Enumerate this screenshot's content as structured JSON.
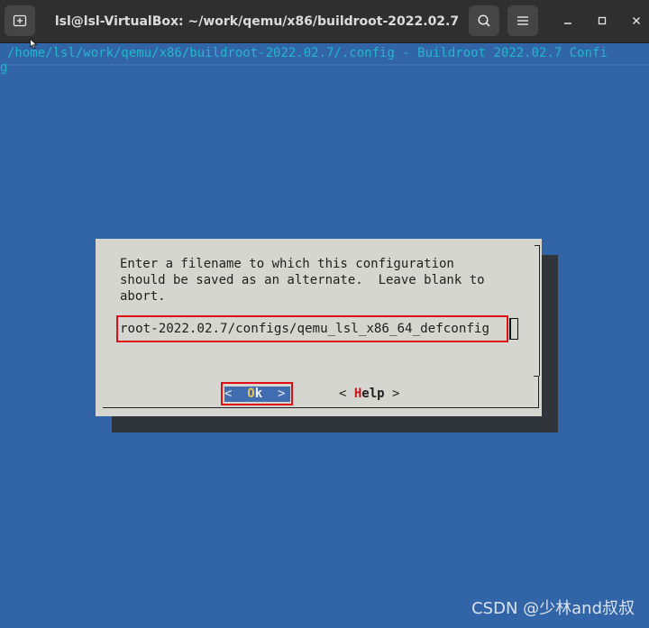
{
  "window": {
    "title": "lsl@lsl-VirtualBox: ~/work/qemu/x86/buildroot-2022.02.7"
  },
  "terminal": {
    "header_line": "/home/lsl/work/qemu/x86/buildroot-2022.02.7/.config - Buildroot 2022.02.7 Confi",
    "header_wrap": "g"
  },
  "dialog": {
    "prompt_line1": "Enter a filename to which this configuration",
    "prompt_line2": "should be saved as an alternate.  Leave blank to",
    "prompt_line3": "abort.",
    "filename_value": "root-2022.02.7/configs/qemu_lsl_x86_64_defconfig",
    "ok_button": {
      "left": "<  ",
      "hotkey": "O",
      "rest": "k",
      "right": "  >"
    },
    "help_button": {
      "left": "< ",
      "hotkey": "H",
      "rest": "elp",
      "right": " >"
    }
  },
  "watermark": "CSDN @少林and叔叔",
  "icons": {
    "new_tab": "new-tab-icon",
    "search": "search-icon",
    "menu": "hamburger-menu-icon",
    "minimize": "minimize-icon",
    "maximize": "maximize-icon",
    "close": "close-icon"
  },
  "colors": {
    "terminal_bg": "#3264a8",
    "dialog_bg": "#d6d6d0",
    "highlight_box": "#e00d17",
    "path_text": "#25b6c9"
  }
}
